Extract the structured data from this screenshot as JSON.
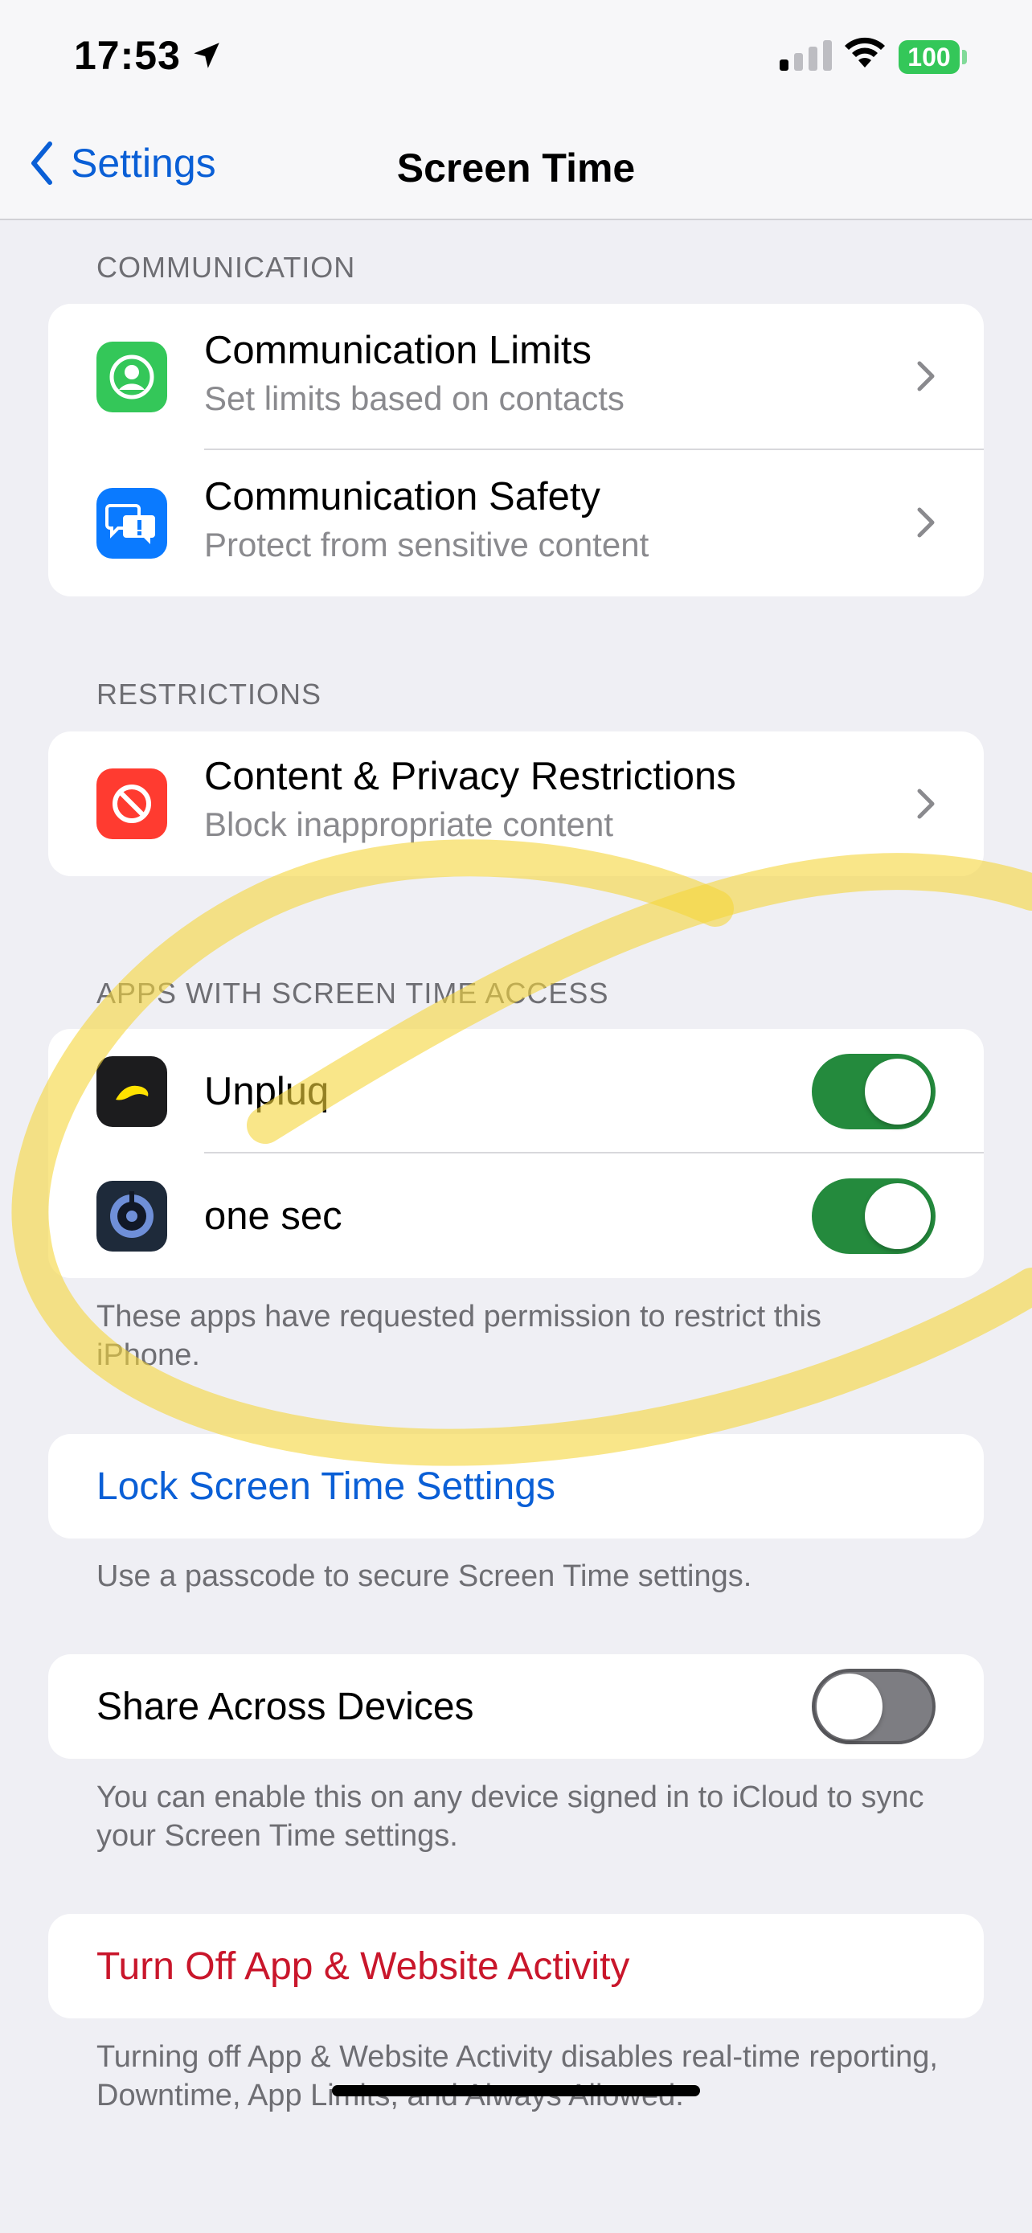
{
  "status_bar": {
    "time": "17:53",
    "battery": "100"
  },
  "nav": {
    "back_label": "Settings",
    "title": "Screen Time"
  },
  "communication": {
    "header": "COMMUNICATION",
    "rows": [
      {
        "title": "Communication Limits",
        "subtitle": "Set limits based on contacts"
      },
      {
        "title": "Communication Safety",
        "subtitle": "Protect from sensitive content"
      }
    ]
  },
  "restrictions": {
    "header": "RESTRICTIONS",
    "row": {
      "title": "Content & Privacy Restrictions",
      "subtitle": "Block inappropriate content"
    }
  },
  "apps_access": {
    "header": "APPS WITH SCREEN TIME ACCESS",
    "apps": [
      {
        "name": "Unpluq",
        "enabled": true
      },
      {
        "name": "one sec",
        "enabled": true
      }
    ],
    "footer": "These apps have requested permission to restrict this iPhone."
  },
  "lock": {
    "label": "Lock Screen Time Settings",
    "footer": "Use a passcode to secure Screen Time settings."
  },
  "share": {
    "label": "Share Across Devices",
    "enabled": false,
    "footer": "You can enable this on any device signed in to iCloud to sync your Screen Time settings."
  },
  "turn_off": {
    "label": "Turn Off App & Website Activity",
    "footer": "Turning off App & Website Activity disables real-time reporting, Downtime, App Limits, and Always Allowed."
  },
  "colors": {
    "accent_blue": "#0a5fd6",
    "destructive_red": "#c9162b",
    "toggle_on": "#248a3d",
    "highlight_yellow": "#f5d63a"
  }
}
